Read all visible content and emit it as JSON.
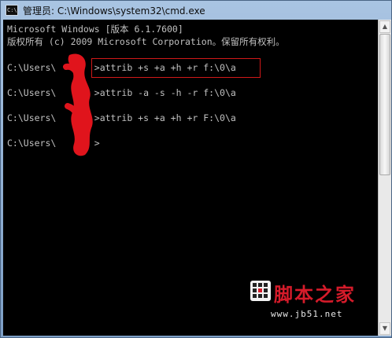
{
  "window": {
    "title": "管理员: C:\\Windows\\system32\\cmd.exe",
    "icon": "cmd-icon"
  },
  "console": {
    "lines": [
      "Microsoft Windows [版本 6.1.7600]",
      "版权所有 (c) 2009 Microsoft Corporation。保留所有权利。",
      "C:\\Users\\       >attrib +s +a +h +r f:\\0\\a",
      "C:\\Users\\       >attrib -a -s -h -r f:\\0\\a",
      "C:\\Users\\       >attrib +s +a +h +r F:\\0\\a",
      "C:\\Users\\       >"
    ]
  },
  "colors": {
    "console_bg": "#000000",
    "console_text": "#c0c0c0",
    "annotation_red": "#d01818",
    "redaction_red": "#e0141c"
  },
  "watermark": {
    "title": "脚本之家",
    "url": "www.jb51.net"
  }
}
